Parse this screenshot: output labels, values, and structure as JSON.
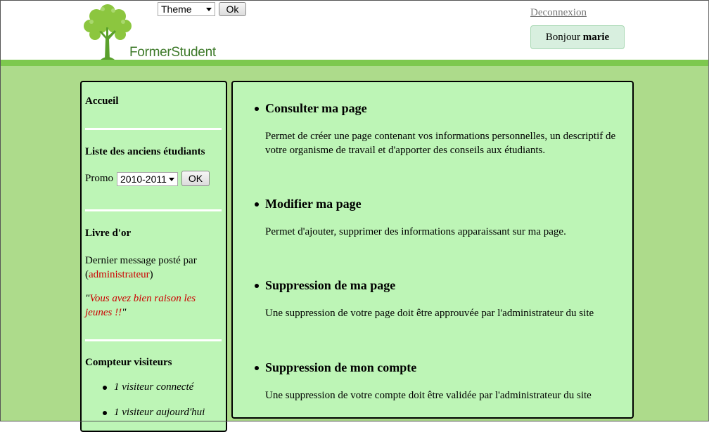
{
  "header": {
    "logo_text": "FormerStudent",
    "theme_select_value": "Theme",
    "theme_ok_label": "Ok",
    "logout_label": "Deconnexion",
    "greeting_prefix": "Bonjour",
    "greeting_user": "marie"
  },
  "sidebar": {
    "home_label": "Accueil",
    "alumni_title": "Liste des anciens étudiants",
    "promo_label": "Promo",
    "promo_value": "2010-2011",
    "promo_ok_label": "OK",
    "guestbook_title": "Livre d'or",
    "last_message_prefix": "Dernier message posté par (",
    "last_message_author": "administrateur",
    "last_message_suffix": ")",
    "quote_open": "\"",
    "quote_text": "Vous avez bien raison les jeunes !!",
    "quote_close": "\"",
    "visitor_title": "Compteur visiteurs",
    "visitor_stats": [
      "1 visiteur connecté",
      "1 visiteur aujourd'hui"
    ]
  },
  "main": {
    "items": [
      {
        "title": "Consulter ma page",
        "description": "Permet de créer une page contenant vos informations personnelles, un descriptif de votre organisme de travail et d'apporter des conseils aux étudiants."
      },
      {
        "title": "Modifier ma page",
        "description": "Permet d'ajouter, supprimer des informations apparaissant sur ma page."
      },
      {
        "title": "Suppression de ma page",
        "description": "Une suppression de votre page doit être approuvée par l'administrateur du site"
      },
      {
        "title": "Suppression de mon compte",
        "description": "Une suppression de votre compte doit être validée par l'administrateur du site"
      }
    ]
  },
  "colors": {
    "header_bar": "#7dc84e",
    "page_background": "#addb8b",
    "panel_background": "#bdf5b6",
    "link_red": "#cc0000"
  }
}
